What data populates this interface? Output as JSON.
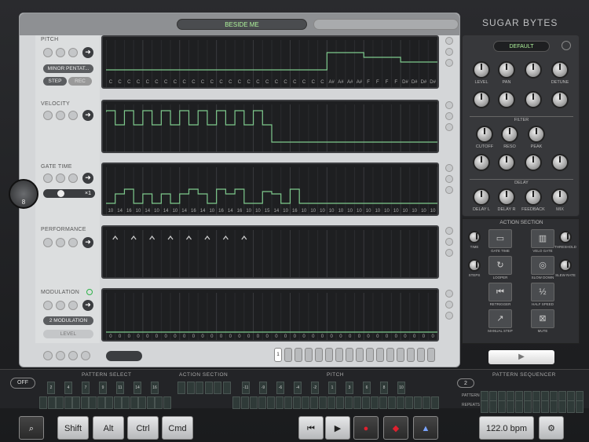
{
  "header": {
    "pattern_name": "BESIDE ME",
    "brand": "SUGAR BYTES"
  },
  "lanes": {
    "pitch": {
      "label": "PITCH",
      "scale": "MINOR PENTAT...",
      "step": "STEP",
      "rec": "REC",
      "octave_top": "C",
      "octave_bottom": "1",
      "notes": [
        "C",
        "C",
        "C",
        "C",
        "C",
        "C",
        "C",
        "C",
        "C",
        "C",
        "C",
        "C",
        "C",
        "C",
        "C",
        "C",
        "C",
        "C",
        "C",
        "C",
        "C",
        "C",
        "C",
        "C",
        "A#",
        "A#",
        "A#",
        "A#",
        "F",
        "F",
        "F",
        "F",
        "D#",
        "D#",
        "D#",
        "D#"
      ]
    },
    "velocity": {
      "label": "VELOCITY"
    },
    "gate": {
      "label": "GATE TIME",
      "multiplier": "×1",
      "values": [
        "10",
        "14",
        "16",
        "10",
        "14",
        "10",
        "14",
        "10",
        "14",
        "16",
        "14",
        "10",
        "16",
        "14",
        "16",
        "10",
        "10",
        "15",
        "14",
        "10",
        "16",
        "10",
        "10",
        "10",
        "10",
        "10",
        "10",
        "10",
        "10",
        "10",
        "10",
        "10",
        "10",
        "10",
        "10",
        "10"
      ]
    },
    "performance": {
      "label": "PERFORMANCE"
    },
    "modulation": {
      "label": "MODULATION",
      "mode": "2 MODULATION",
      "target": "LEVEL"
    }
  },
  "footer": {
    "pattern_count_label": "8",
    "pages": [
      "1",
      "2",
      "3",
      "4",
      "5",
      "6",
      "7",
      "8",
      "9",
      "10",
      "11",
      "12",
      "13",
      "14",
      "15",
      "16"
    ]
  },
  "synth": {
    "preset": "DEFAULT",
    "knobs_row1": [
      "LEVEL",
      "PAN",
      "",
      "DETUNE"
    ],
    "filter": {
      "title": "FILTER",
      "knobs": [
        "CUTOFF",
        "RESO",
        "PEAK"
      ]
    },
    "delay": {
      "title": "DELAY",
      "knobs": [
        "DELAY L",
        "DELAY R",
        "FEEDBACK",
        "MIX"
      ]
    }
  },
  "action": {
    "title": "ACTION SECTION",
    "items": [
      {
        "label": "GATE TIME",
        "icon": "▭"
      },
      {
        "label": "VELO GATE",
        "icon": "▥"
      },
      {
        "label": "LOOPER",
        "icon": "↻"
      },
      {
        "label": "SLOW DOWN",
        "icon": "◎"
      },
      {
        "label": "RETRIGGER",
        "icon": "⏮"
      },
      {
        "label": "HALF SPEED",
        "icon": "½"
      },
      {
        "label": "MANUAL STEP",
        "icon": "↗"
      },
      {
        "label": "MUTE",
        "icon": "⊠"
      }
    ],
    "knobs": [
      "TIME",
      "THRESHOLD",
      "STEPS",
      "SLEW RATE"
    ]
  },
  "bottom": {
    "off": "OFF",
    "pattern_select": "PATTERN SELECT",
    "action_section": "ACTION SECTION",
    "pitch": "PITCH",
    "pattern_sequencer": "PATTERN SEQUENCER",
    "seq_count": "2",
    "pattern_row_label": "PATTERN",
    "repeats_row_label": "REPEATS",
    "pattern_keys": [
      "2",
      "4",
      "7",
      "9",
      "11",
      "14",
      "16"
    ],
    "pitch_keys": [
      "-11",
      "-9",
      "-6",
      "-4",
      "-2",
      "1",
      "3",
      "6",
      "8",
      "10"
    ]
  },
  "toolbar": {
    "shift": "Shift",
    "alt": "Alt",
    "ctrl": "Ctrl",
    "cmd": "Cmd",
    "bpm": "122.0 bpm"
  },
  "colors": {
    "accent_green": "#aef29b",
    "lane_bg": "#1e1f21"
  }
}
